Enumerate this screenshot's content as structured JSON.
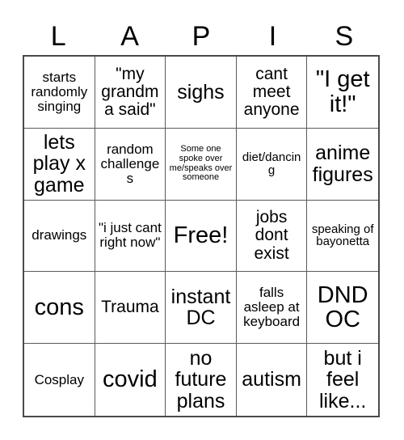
{
  "card": {
    "title_letters": [
      "L",
      "A",
      "P",
      "I",
      "S"
    ],
    "grid": {
      "rows": 5,
      "columns": 5,
      "cells": [
        {
          "text": "starts randomly singing",
          "size": "md"
        },
        {
          "text": "\"my grandma said\"",
          "size": "lg"
        },
        {
          "text": "sighs",
          "size": "xl"
        },
        {
          "text": "cant meet anyone",
          "size": "lg"
        },
        {
          "text": "\"I get it!\"",
          "size": "xxl"
        },
        {
          "text": "lets play x game",
          "size": "xl"
        },
        {
          "text": "random challenges",
          "size": "md"
        },
        {
          "text": "Some one spoke over me/speaks over someone",
          "size": "xs"
        },
        {
          "text": "diet/dancing",
          "size": "sm"
        },
        {
          "text": "anime figures",
          "size": "xl"
        },
        {
          "text": "drawings",
          "size": "md"
        },
        {
          "text": "\"i just cant right now\"",
          "size": "md"
        },
        {
          "text": "Free!",
          "size": "xxl"
        },
        {
          "text": "jobs dont exist",
          "size": "lg"
        },
        {
          "text": "speaking of bayonetta",
          "size": "sm"
        },
        {
          "text": "cons",
          "size": "xxl"
        },
        {
          "text": "Trauma",
          "size": "lg"
        },
        {
          "text": "instant DC",
          "size": "xl"
        },
        {
          "text": "falls asleep at keyboard",
          "size": "md"
        },
        {
          "text": "DND OC",
          "size": "xxl"
        },
        {
          "text": "Cosplay",
          "size": "md"
        },
        {
          "text": "covid",
          "size": "xxl"
        },
        {
          "text": "no future plans",
          "size": "xl"
        },
        {
          "text": "autism",
          "size": "xl"
        },
        {
          "text": "but i feel like...",
          "size": "xl"
        }
      ]
    },
    "colors": {
      "background": "#ffffff",
      "text": "#000000",
      "grid_outer_border": "#4a4a4a",
      "grid_inner_border": "#5a5a5a"
    }
  }
}
